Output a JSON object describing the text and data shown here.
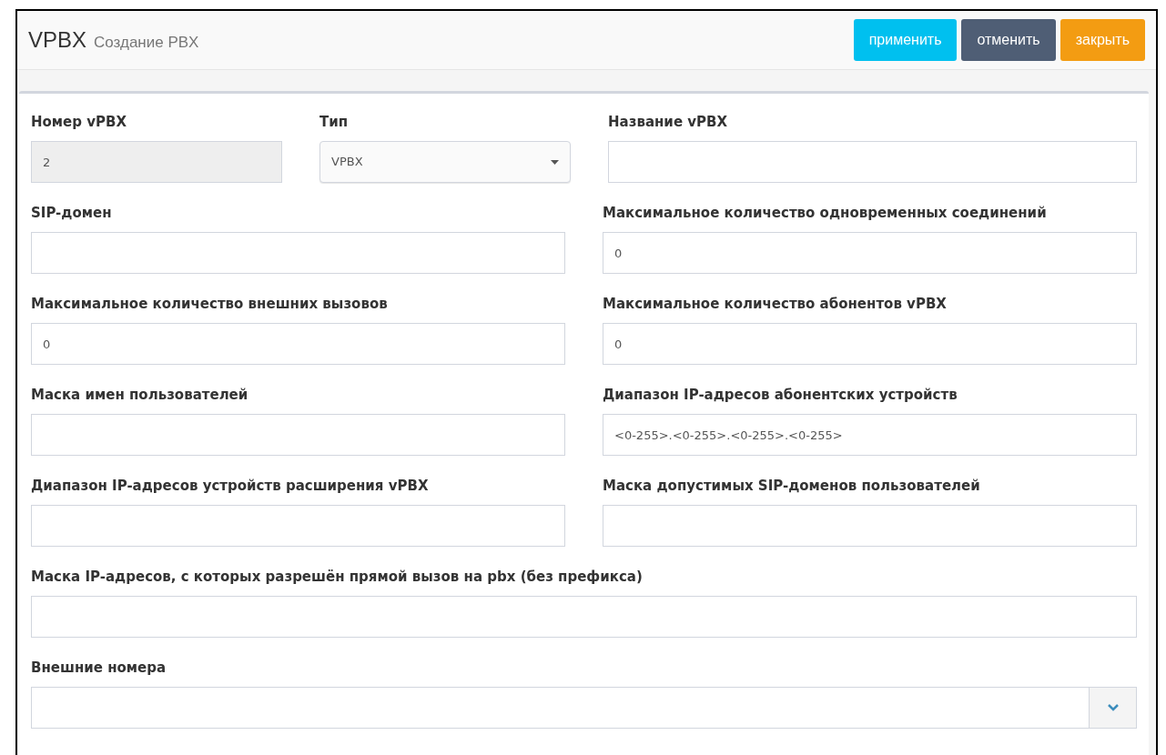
{
  "header": {
    "title": "VPBX",
    "subtitle": "Создание PBX",
    "buttons": [
      {
        "label": "применить",
        "kind": "apply"
      },
      {
        "label": "отменить",
        "kind": "cancel"
      },
      {
        "label": "закрыть",
        "kind": "close"
      }
    ]
  },
  "rows": [
    [
      {
        "label": "Номер vPBX",
        "kind": "readonly",
        "value": "2"
      },
      {
        "label": "Тип",
        "kind": "select",
        "value": "VPBX"
      },
      {
        "label": "Название vPBX",
        "kind": "input"
      }
    ],
    [
      {
        "label": "SIP-домен",
        "kind": "input"
      },
      {
        "label": "Максимальное количество одновременных соединений",
        "kind": "input",
        "value": "0"
      }
    ],
    [
      {
        "label": "Максимальное количество внешних вызовов",
        "kind": "input",
        "value": "0"
      },
      {
        "label": "Максимальное количество абонентов vPBX",
        "kind": "input",
        "value": "0"
      }
    ],
    [
      {
        "label": "Маска имен пользователей",
        "kind": "input"
      },
      {
        "label": "Диапазон IP-адресов абонентских устройств",
        "kind": "input",
        "value": "<0-255>.<0-255>.<0-255>.<0-255>"
      }
    ],
    [
      {
        "label": "Диапазон IP-адресов устройств расширения vPBX",
        "kind": "input"
      },
      {
        "label": "Маска допустимых SIP-доменов пользователей",
        "kind": "input"
      }
    ],
    [
      {
        "label": "Маска IP-адресов, с которых разрешён прямой вызов на pbx (без префикса)",
        "kind": "input"
      }
    ],
    [
      {
        "label": "Внешние номера",
        "kind": "multiselect"
      }
    ]
  ]
}
